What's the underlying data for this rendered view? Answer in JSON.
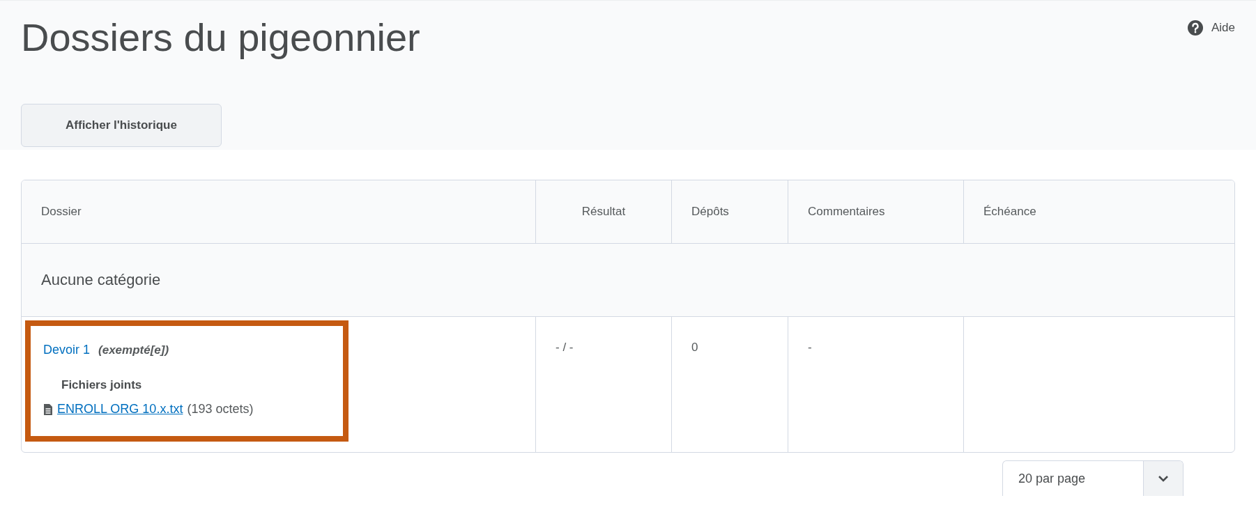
{
  "header": {
    "title": "Dossiers du pigeonnier",
    "help_link": "Aide"
  },
  "history_button": "Afficher l'historique",
  "table": {
    "columns": [
      "Dossier",
      "Résultat",
      "Dépôts",
      "Commentaires",
      "Échéance"
    ],
    "category": "Aucune catégorie",
    "rows": [
      {
        "name": "Devoir 1",
        "status": "(exempté[e])",
        "attachments_label": "Fichiers joints",
        "file": "ENROLL ORG 10.x.txt",
        "file_size": "(193 octets)",
        "result": "- / -",
        "submissions": "0",
        "comments": "-",
        "highlighted": true
      }
    ]
  },
  "pager": {
    "value": "20 par page"
  }
}
